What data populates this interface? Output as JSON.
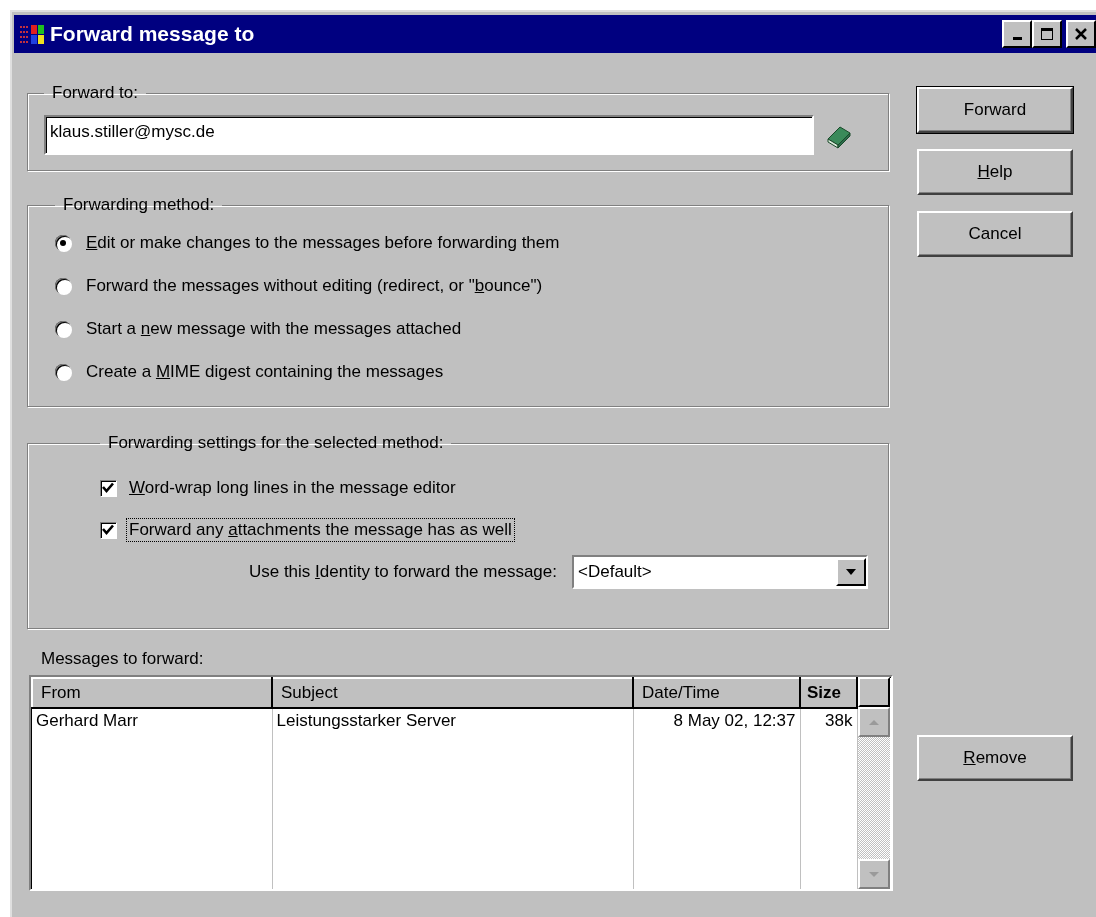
{
  "window": {
    "title": "Forward message to"
  },
  "forward_to": {
    "legend": "Forward to:",
    "value": "klaus.stiller@mysc.de"
  },
  "method": {
    "legend": "Forwarding method:",
    "options": [
      {
        "key": "E",
        "after": "dit or make changes to the messages before forwarding them",
        "selected": true
      },
      {
        "before": "Forward the messages without editing (redirect, or \"",
        "key": "b",
        "after": "ounce\")",
        "selected": false
      },
      {
        "before": "Start a ",
        "key": "n",
        "after": "ew message with the messages attached",
        "selected": false
      },
      {
        "before": "Create a ",
        "key": "M",
        "after": "IME digest containing the messages",
        "selected": false
      }
    ]
  },
  "settings": {
    "legend": "Forwarding settings for the selected method:",
    "checkboxes": [
      {
        "key": "W",
        "after": "ord-wrap long lines in the message editor",
        "checked": true,
        "focused": false
      },
      {
        "before": "Forward any ",
        "key": "a",
        "after": "ttachments the message has as well",
        "checked": true,
        "focused": true
      }
    ],
    "identity": {
      "before": "Use this ",
      "key": "I",
      "after": "dentity to forward the message:",
      "value": "<Default>"
    }
  },
  "messages": {
    "label": "Messages to forward:",
    "columns": [
      {
        "label": "From",
        "sorted": false
      },
      {
        "label": "Subject",
        "sorted": false
      },
      {
        "label": "Date/Time",
        "sorted": false
      },
      {
        "label": "Size",
        "sorted": true
      }
    ],
    "rows": [
      {
        "from": "Gerhard Marr",
        "subject": "Leistungsstarker Server",
        "date": "8 May 02, 12:37",
        "size": "38k"
      }
    ]
  },
  "buttons": [
    {
      "before": "Forward"
    },
    {
      "key": "H",
      "after": "elp"
    },
    {
      "before": "Cancel"
    }
  ],
  "remove_button": {
    "key": "R",
    "after": "emove"
  }
}
